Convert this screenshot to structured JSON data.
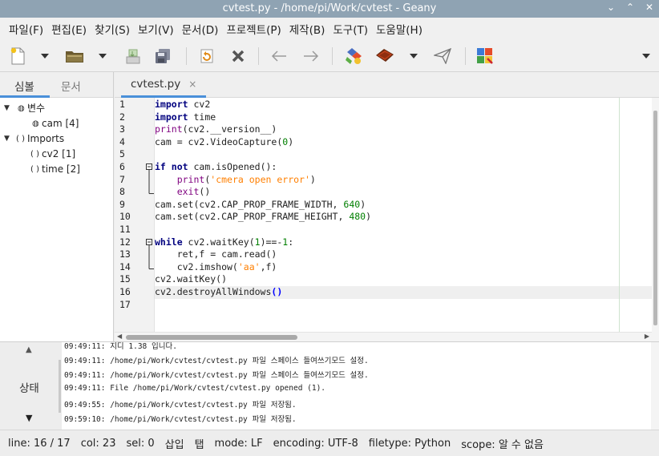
{
  "window": {
    "title": "cvtest.py - /home/pi/Work/cvtest - Geany",
    "controls": [
      "⌄",
      "⌃",
      "✕"
    ]
  },
  "menu": [
    "파일(F)",
    "편집(E)",
    "찾기(S)",
    "보기(V)",
    "문서(D)",
    "프로젝트(P)",
    "제작(B)",
    "도구(T)",
    "도움말(H)"
  ],
  "toolbar": {
    "icons": [
      "new-file-icon",
      "dropdown-icon",
      "open-folder-icon",
      "dropdown-icon",
      "save-icon",
      "save-all-icon",
      "revert-icon",
      "close-doc-icon",
      "back-arrow-icon",
      "forward-arrow-icon",
      "compile-icon",
      "build-icon",
      "dropdown-icon",
      "send-icon",
      "color-chooser-icon",
      "overflow-dropdown-icon"
    ]
  },
  "sidebar": {
    "tabs": [
      "심볼",
      "문서"
    ],
    "tree": [
      {
        "label": "변수",
        "level": 0,
        "expanded": true,
        "icon": "variable-icon"
      },
      {
        "label": "cam [4]",
        "level": 1,
        "icon": "variable-icon"
      },
      {
        "label": "Imports",
        "level": 0,
        "expanded": true,
        "icon": "import-icon"
      },
      {
        "label": "cv2 [1]",
        "level": 1,
        "icon": "import-icon"
      },
      {
        "label": "time [2]",
        "level": 1,
        "icon": "import-icon"
      }
    ]
  },
  "editor": {
    "tab_label": "cvtest.py",
    "tab_close": "×",
    "current_line": 16,
    "lines": [
      [
        [
          "kw",
          "import"
        ],
        [
          "op",
          " cv2"
        ]
      ],
      [
        [
          "kw",
          "import"
        ],
        [
          "op",
          " time"
        ]
      ],
      [
        [
          "fn",
          "print"
        ],
        [
          "op",
          "(cv2.__version__)"
        ]
      ],
      [
        [
          "op",
          "cam = cv2.VideoCapture("
        ],
        [
          "num",
          "0"
        ],
        [
          "op",
          ")"
        ]
      ],
      [],
      [
        [
          "kw",
          "if"
        ],
        [
          "op",
          " "
        ],
        [
          "kw",
          "not"
        ],
        [
          "op",
          " cam.isOpened():"
        ]
      ],
      [
        [
          "op",
          "    "
        ],
        [
          "fn",
          "print"
        ],
        [
          "op",
          "("
        ],
        [
          "str",
          "'cmera open error'"
        ],
        [
          "op",
          ")"
        ]
      ],
      [
        [
          "op",
          "    "
        ],
        [
          "fn",
          "exit"
        ],
        [
          "op",
          "()"
        ]
      ],
      [
        [
          "op",
          "cam.set(cv2.CAP_PROP_FRAME_WIDTH, "
        ],
        [
          "num",
          "640"
        ],
        [
          "op",
          ")"
        ]
      ],
      [
        [
          "op",
          "cam.set(cv2.CAP_PROP_FRAME_HEIGHT, "
        ],
        [
          "num",
          "480"
        ],
        [
          "op",
          ")"
        ]
      ],
      [],
      [
        [
          "kw",
          "while"
        ],
        [
          "op",
          " cv2.waitKey("
        ],
        [
          "num",
          "1"
        ],
        [
          "op",
          ")==-"
        ],
        [
          "num",
          "1"
        ],
        [
          "op",
          ":"
        ]
      ],
      [
        [
          "op",
          "    ret,f = cam.read()"
        ]
      ],
      [
        [
          "op",
          "    cv2.imshow("
        ],
        [
          "str",
          "'aa'"
        ],
        [
          "op",
          ",f)"
        ]
      ],
      [
        [
          "op",
          "cv2.waitKey()"
        ]
      ],
      [
        [
          "op",
          "cv2.destroyAllWindows"
        ],
        [
          "br",
          "()"
        ]
      ],
      []
    ],
    "folds": [
      {
        "start": 6,
        "end": 8
      },
      {
        "start": 12,
        "end": 14
      }
    ]
  },
  "messages": {
    "panel_label": "상태",
    "lines": [
      "09:49:11: 지디 1.38 입니다.",
      "09:49:11: /home/pi/Work/cvtest/cvtest.py 파일 스페이스 들여쓰기모드 설정.",
      "09:49:11: /home/pi/Work/cvtest/cvtest.py 파일 스페이스 들여쓰기모드 설정.",
      "09:49:11: File /home/pi/Work/cvtest/cvtest.py opened (1).",
      "09:49:55: /home/pi/Work/cvtest/cvtest.py 파일 저장됨.",
      "09:59:10: /home/pi/Work/cvtest/cvtest.py 파일 저장됨."
    ]
  },
  "status": {
    "line": "line: 16 / 17",
    "col": "col: 23",
    "sel": "sel: 0",
    "mode": "삽입",
    "indent": "탭",
    "eol": "mode: LF",
    "encoding": "encoding: UTF-8",
    "filetype": "filetype: Python",
    "scope": "scope: 알 수 없음"
  }
}
